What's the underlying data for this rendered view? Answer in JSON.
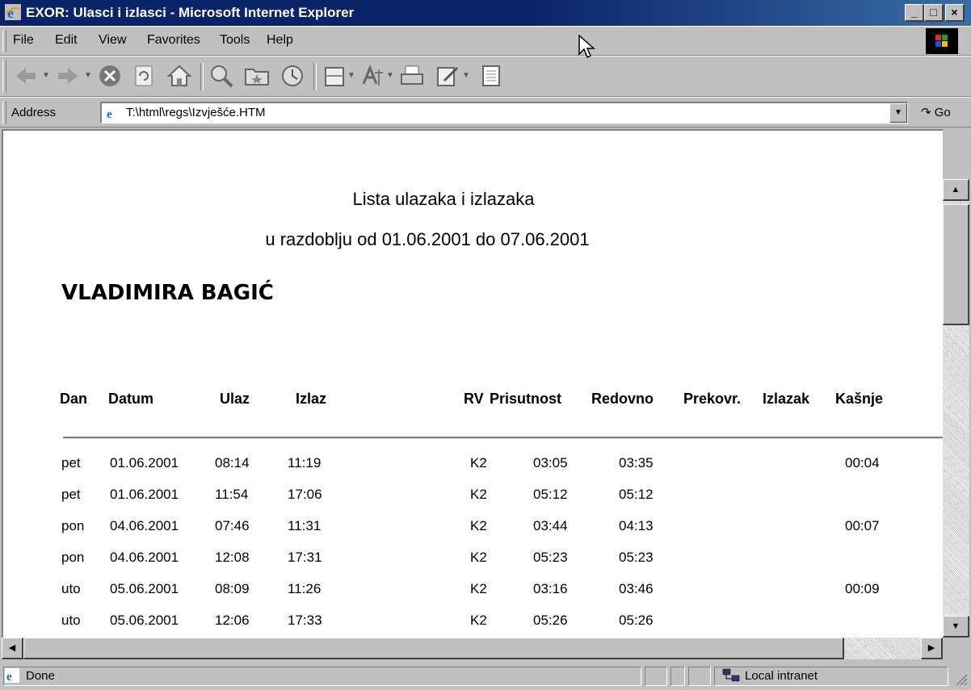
{
  "window": {
    "title": "EXOR: Ulasci i izlasci - Microsoft Internet Explorer"
  },
  "menu": {
    "file": "File",
    "edit": "Edit",
    "view": "View",
    "favorites": "Favorites",
    "tools": "Tools",
    "help": "Help"
  },
  "address": {
    "label": "Address",
    "url": "T:\\html\\regs\\Izvješće.HTM",
    "go": "Go"
  },
  "report": {
    "title": "Lista ulazaka i izlazaka",
    "period": "u razdoblju od 01.06.2001 do 07.06.2001",
    "person": "VLADIMIRA BAGIĆ",
    "columns": [
      "Dan",
      "Datum",
      "Ulaz",
      "Izlaz",
      "RV",
      "Prisutnost",
      "Redovno",
      "Prekovr.",
      "Izlazak",
      "Kašnje"
    ],
    "rows": [
      [
        "pet",
        "01.06.2001",
        "08:14",
        "11:19",
        "K2",
        "03:05",
        "03:35",
        "",
        "",
        "00:04"
      ],
      [
        "pet",
        "01.06.2001",
        "11:54",
        "17:06",
        "K2",
        "05:12",
        "05:12",
        "",
        "",
        ""
      ],
      [
        "pon",
        "04.06.2001",
        "07:46",
        "11:31",
        "K2",
        "03:44",
        "04:13",
        "",
        "",
        "00:07"
      ],
      [
        "pon",
        "04.06.2001",
        "12:08",
        "17:31",
        "K2",
        "05:23",
        "05:23",
        "",
        "",
        ""
      ],
      [
        "uto",
        "05.06.2001",
        "08:09",
        "11:26",
        "K2",
        "03:16",
        "03:46",
        "",
        "",
        "00:09"
      ],
      [
        "uto",
        "05.06.2001",
        "12:06",
        "17:33",
        "K2",
        "05:26",
        "05:26",
        "",
        "",
        ""
      ]
    ]
  },
  "status": {
    "text": "Done",
    "zone": "Local intranet"
  },
  "colors": {
    "titlebar": "#0a246a",
    "chrome": "#c0c0c0",
    "content_bg": "#ffffff"
  }
}
